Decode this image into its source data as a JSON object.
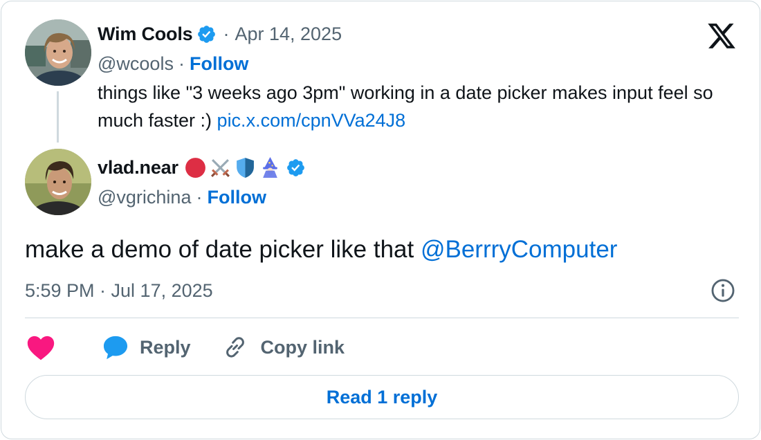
{
  "quoted_tweet": {
    "author_name": "Wim Cools",
    "handle": "@wcools",
    "separator": "·",
    "date": "Apr 14, 2025",
    "follow_label": "Follow",
    "text": "things like \"3 weeks ago 3pm\" working in a date picker makes input feel so much faster :) ",
    "link_text": "pic.x.com/cpnVVa24J8"
  },
  "main_tweet": {
    "author_name": "vlad.near",
    "name_emojis": [
      "red-circle",
      "crossed-swords",
      "shield",
      "mage"
    ],
    "handle": "@vgrichina",
    "separator": "·",
    "follow_label": "Follow",
    "text": "make a demo of date picker like that ",
    "mention": "@BerrryComputer",
    "timestamp": "5:59 PM · Jul 17, 2025"
  },
  "actions": {
    "like_icon": "heart-icon",
    "reply_label": "Reply",
    "copy_link_label": "Copy link"
  },
  "read_replies_label": "Read 1 reply",
  "icons": {
    "brand": "x-logo-icon",
    "verified": "verified-badge-icon",
    "info": "info-icon",
    "reply": "speech-bubble-icon",
    "copy": "link-icon"
  },
  "colors": {
    "link_blue": "#006fd6",
    "verified_blue": "#1d9bf0",
    "like_pink": "#f91880",
    "secondary_text": "#536471",
    "border": "#cfd9de",
    "text": "#0f1419"
  }
}
